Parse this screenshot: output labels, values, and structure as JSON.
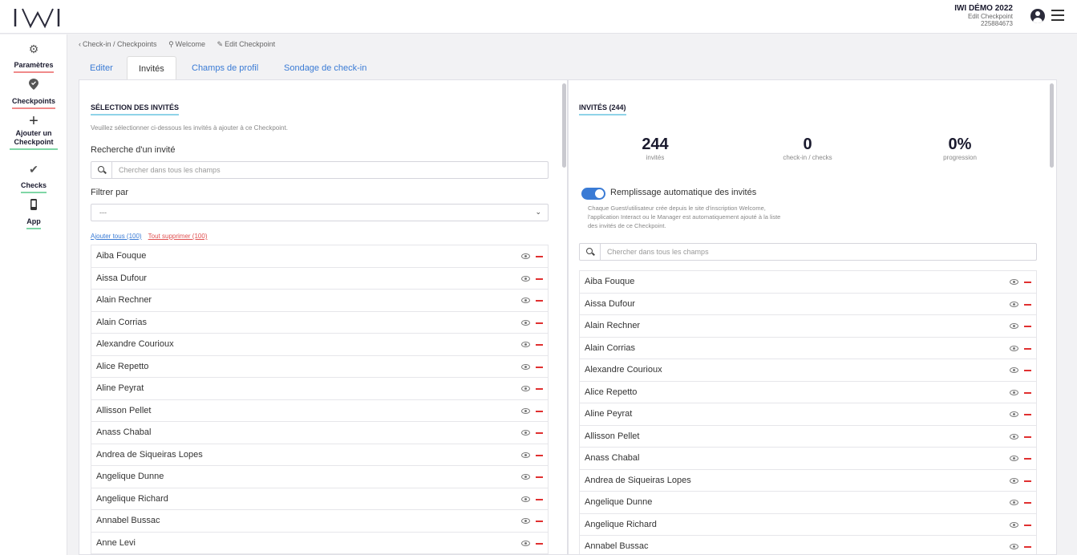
{
  "header": {
    "logo": "IWI",
    "event_title": "IWI DÉMO 2022",
    "page_name": "Edit Checkpoint",
    "code": "225884673"
  },
  "sidebar": {
    "items": [
      {
        "label": "Paramètres",
        "icon": "gear-icon"
      },
      {
        "label": "Checkpoints",
        "icon": "checkpoint-pin-icon"
      },
      {
        "label": "Ajouter un Checkpoint",
        "icon": "plus-icon"
      },
      {
        "label": "Checks",
        "icon": "checkmark-icon"
      },
      {
        "label": "App",
        "icon": "phone-icon"
      }
    ]
  },
  "breadcrumb": {
    "back": "Check-in / Checkpoints",
    "welcome": "Welcome",
    "edit": "Edit Checkpoint"
  },
  "tabs": [
    {
      "label": "Editer"
    },
    {
      "label": "Invités"
    },
    {
      "label": "Champs de profil"
    },
    {
      "label": "Sondage de check-in"
    }
  ],
  "left": {
    "title": "SÉLECTION DES INVITÉS",
    "help": "Veuillez sélectionner ci-dessous les invités à ajouter à ce Checkpoint.",
    "search_label": "Recherche d'un invité",
    "search_placeholder": "Chercher dans tous les champs",
    "filter_label": "Filtrer par",
    "filter_value": "---",
    "add_all": "Ajouter tous (100)",
    "remove_all": "Tout supprimer (100)",
    "guests": [
      "Aiba Fouque",
      "Aissa Dufour",
      "Alain Rechner",
      "Alain Corrias",
      "Alexandre Courioux",
      "Alice Repetto",
      "Aline Peyrat",
      "Allisson Pellet",
      "Anass Chabal",
      "Andrea de Siqueiras Lopes",
      "Angelique Dunne",
      "Angelique Richard",
      "Annabel Bussac",
      "Anne Levi"
    ]
  },
  "right": {
    "title": "INVITÉS (244)",
    "stats": [
      {
        "value": "244",
        "label": "invités"
      },
      {
        "value": "0",
        "label": "check-in / checks"
      },
      {
        "value": "0%",
        "label": "progression"
      }
    ],
    "toggle_label": "Remplissage automatique des invités",
    "toggle_on": true,
    "toggle_desc_1": "Chaque Guest/utilisateur crée depuis le site d'inscription Welcome,",
    "toggle_desc_2": "l'application Interact ou le Manager est automatiquement ajouté à la liste",
    "toggle_desc_3": "des invités de ce Checkpoint.",
    "search_placeholder": "Chercher dans tous les champs",
    "guests": [
      "Aiba Fouque",
      "Aissa Dufour",
      "Alain Rechner",
      "Alain Corrias",
      "Alexandre Courioux",
      "Alice Repetto",
      "Aline Peyrat",
      "Allisson Pellet",
      "Anass Chabal",
      "Andrea de Siqueiras Lopes",
      "Angelique Dunne",
      "Angelique Richard",
      "Annabel Bussac"
    ]
  }
}
